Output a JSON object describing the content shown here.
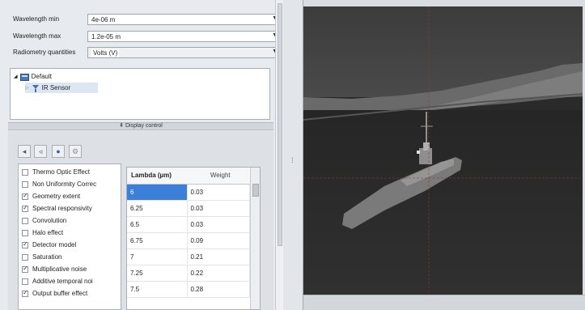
{
  "params": {
    "wavelength_min": {
      "label": "Wavelength min",
      "value": "4e-06 m"
    },
    "wavelength_max": {
      "label": "Wavelength max",
      "value": "1.2e-05 m"
    },
    "radiometry": {
      "label": "Radiometry quantities",
      "value": "Volts (V)"
    }
  },
  "tree": {
    "root": "Default",
    "child": "IR Sensor"
  },
  "display_control": "Display control",
  "effects": [
    {
      "label": "Thermo Optic Effect",
      "checked": false
    },
    {
      "label": "Non Uniformity Correc",
      "checked": false
    },
    {
      "label": "Geometry extent",
      "checked": true
    },
    {
      "label": "Spectral responsivity",
      "checked": true
    },
    {
      "label": "Convolution",
      "checked": false
    },
    {
      "label": "Halo effect",
      "checked": false
    },
    {
      "label": "Detector model",
      "checked": true
    },
    {
      "label": "Saturation",
      "checked": false
    },
    {
      "label": "Multiplicative noise",
      "checked": true
    },
    {
      "label": "Additive temporal noi",
      "checked": false
    },
    {
      "label": "Output buffer effect",
      "checked": true
    }
  ],
  "lambda_table": {
    "headers": [
      "Lambda (µm)",
      "Weight"
    ],
    "rows": [
      [
        "6",
        "0.03"
      ],
      [
        "6.25",
        "0.03"
      ],
      [
        "6.5",
        "0.03"
      ],
      [
        "6.75",
        "0.09"
      ],
      [
        "7",
        "0.21"
      ],
      [
        "7.25",
        "0.22"
      ],
      [
        "7.5",
        "0.28"
      ]
    ]
  }
}
